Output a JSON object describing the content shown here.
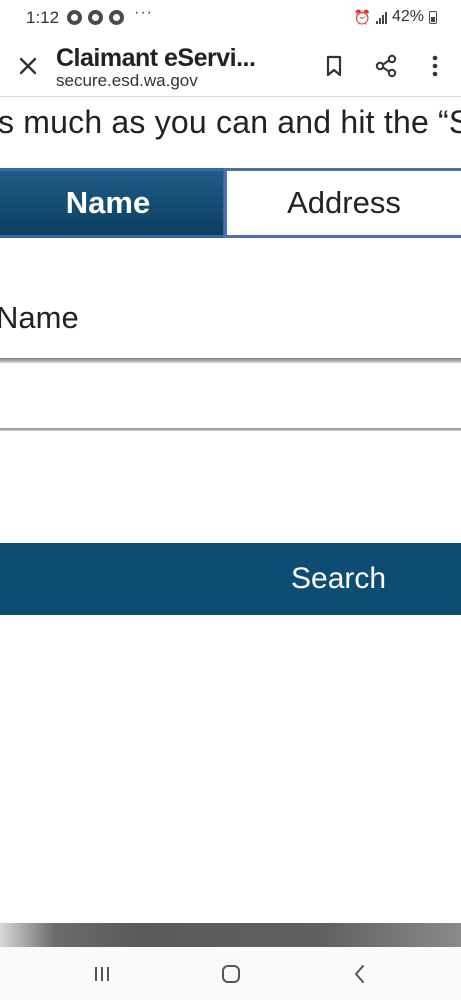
{
  "status_bar": {
    "time": "1:12",
    "more": "···",
    "battery": "42%",
    "app_icons": [
      "chrome-icon",
      "chrome-icon",
      "chrome-icon"
    ]
  },
  "browser": {
    "title": "Claimant eServi...",
    "domain": "secure.esd.wa.gov",
    "icons": [
      "close-icon",
      "bookmark-icon",
      "share-icon",
      "more-vert-icon"
    ]
  },
  "page": {
    "instructions": "s much as you can and hit the “S",
    "tabs": [
      {
        "label": "Name",
        "active": true
      },
      {
        "label": "Address",
        "active": false
      }
    ],
    "field_label": "Name",
    "name_value": "",
    "search_label": "Search"
  },
  "nav_bar": {
    "icons": [
      "recents-icon",
      "home-icon",
      "back-icon"
    ]
  },
  "colors": {
    "primary": "#0d4c73",
    "tab_border": "#4b6fb3",
    "text": "#222222"
  }
}
